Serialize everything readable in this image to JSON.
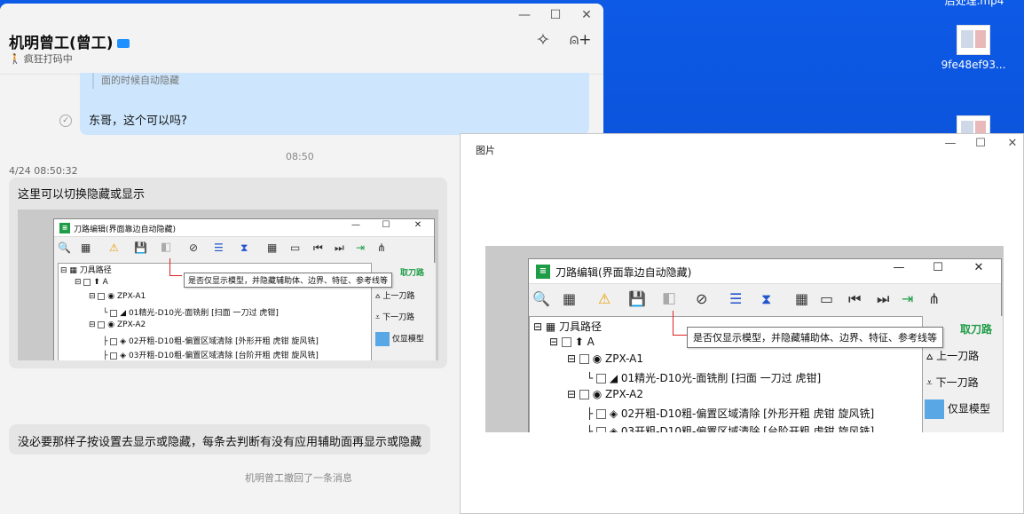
{
  "desktop": {
    "icons": [
      {
        "label": "后处理.mp4"
      },
      {
        "label": "9fe48ef93..."
      }
    ]
  },
  "chat": {
    "window_controls": {
      "minimize": "—",
      "maximize": "☐",
      "close": "✕"
    },
    "title": "机明曾工(曾工)",
    "status": "疯狂打码中",
    "messages": {
      "quote": "面的时候自动隐藏",
      "question": "东哥，这个可以吗?",
      "time_center": "08:50",
      "time_left": "4/24 08:50:32",
      "toggle_msg": "这里可以切换隐藏或显示",
      "long_msg": "没必要那样子按设置去显示或隐藏，每条去判断有没有应用辅助面再显示或隐藏",
      "recall": "机明曾工撤回了一条消息"
    }
  },
  "tool_window": {
    "title": "刀路编辑(界面靠边自动隐藏)",
    "tooltip": "是否仅显示模型，并隐藏辅助体、边界、特征、参考线等",
    "tree": [
      {
        "label": "刀具路径",
        "level": 0
      },
      {
        "label": "A",
        "level": 1
      },
      {
        "label": "ZPX-A1",
        "level": 2
      },
      {
        "label": "01精光-D10光-面铣削 [扫面 一刀过 虎钳]",
        "level": 3
      },
      {
        "label": "ZPX-A2",
        "level": 2
      },
      {
        "label": "02开粗-D10粗-偏置区域清除 [外形开粗 虎钳 旋风铣]",
        "level": 3
      },
      {
        "label": "03开粗-D10粗-偏置区域清除 [台阶开粗 虎钳 旋风铣]",
        "level": 3
      }
    ],
    "side": {
      "active": "取刀路",
      "prev": "上一刀路",
      "next": "下一刀路",
      "only_model": "仅显模型"
    }
  },
  "viewer": {
    "title": "图片",
    "window_controls": {
      "minimize": "—",
      "maximize": "☐",
      "close": "✕"
    }
  }
}
